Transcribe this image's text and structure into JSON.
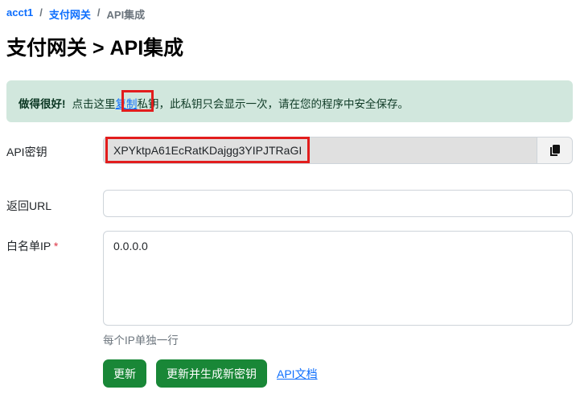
{
  "breadcrumb": {
    "items": [
      "acct1",
      "支付网关"
    ],
    "current": "API集成",
    "separator": "/"
  },
  "page_title": "支付网关 > API集成",
  "alert": {
    "strong": "做得很好!",
    "before": "点击这里",
    "link": "复制",
    "after": "私钥，此私钥只会显示一次，请在您的程序中安全保存。"
  },
  "form": {
    "api_key": {
      "label": "API密钥",
      "value": "XPYktpA61EcRatKDajgg3YIPJTRaGI"
    },
    "return_url": {
      "label": "返回URL",
      "value": ""
    },
    "whitelist": {
      "label": "白名单IP",
      "required": "*",
      "value": "0.0.0.0",
      "help": "每个IP单独一行"
    }
  },
  "buttons": {
    "update": "更新",
    "update_regen": "更新并生成新密钥",
    "docs": "API文档"
  },
  "colors": {
    "primary": "#198737",
    "link": "#0d6efd",
    "alert_bg": "#d1e7dd",
    "highlight": "#e21d1d"
  }
}
